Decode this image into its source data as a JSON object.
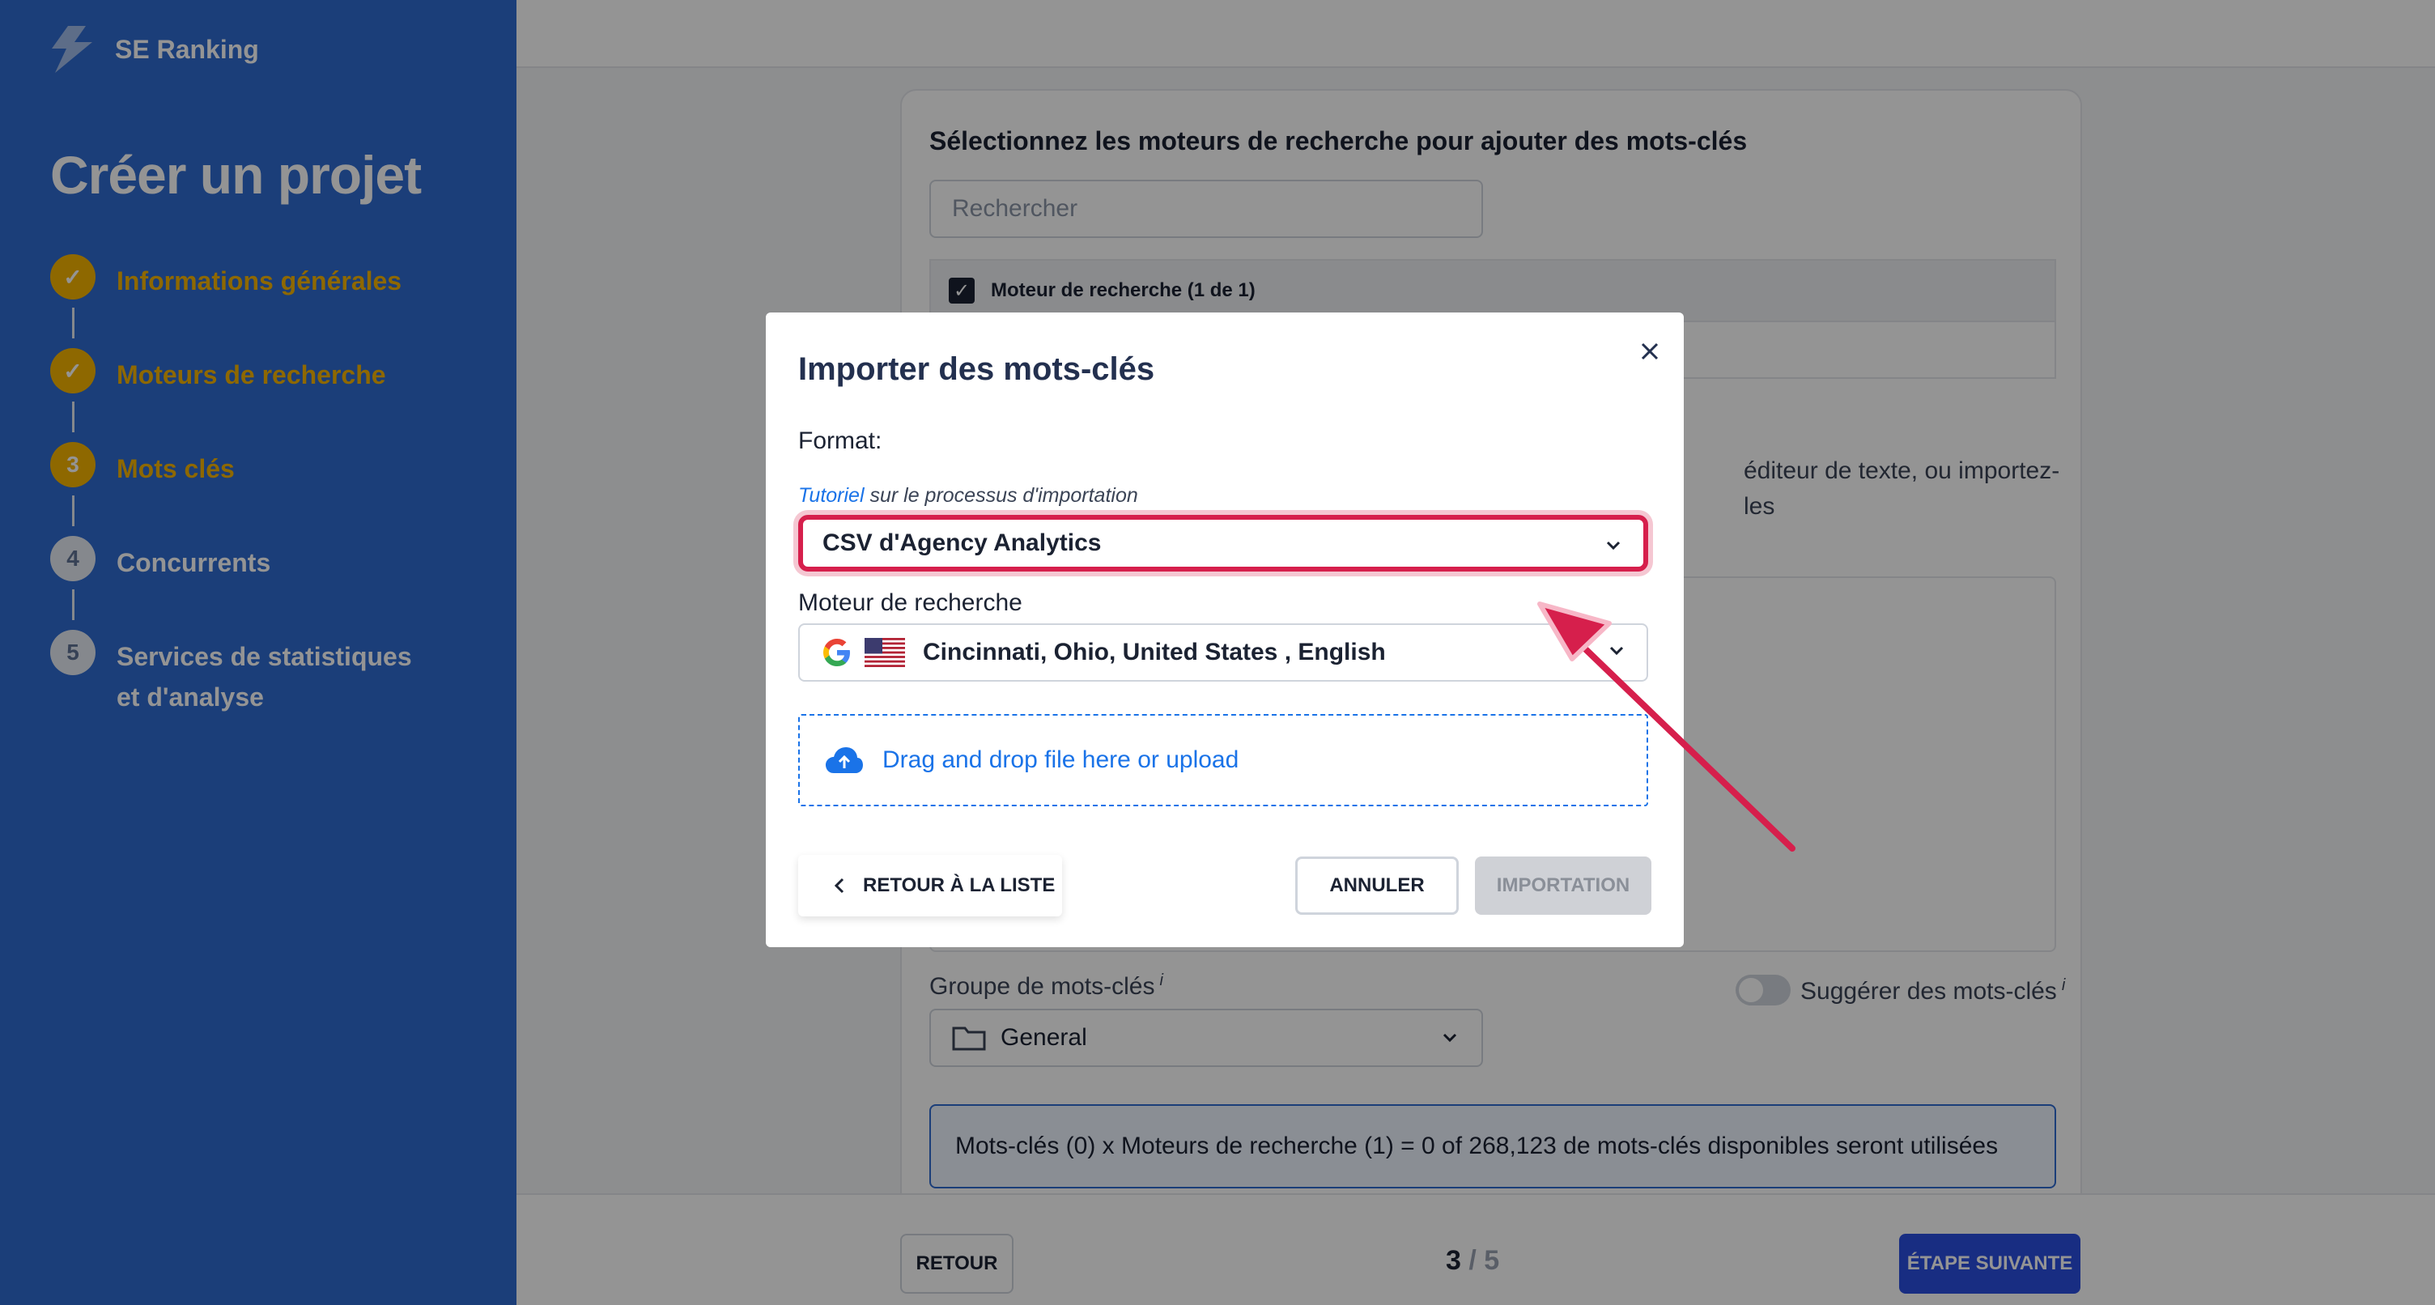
{
  "brand": {
    "name": "SE Ranking"
  },
  "sidebar": {
    "title": "Créer un projet",
    "steps": [
      {
        "number": "1",
        "label": "Informations générales",
        "state": "done"
      },
      {
        "number": "2",
        "label": "Moteurs de recherche",
        "state": "done"
      },
      {
        "number": "3",
        "label": "Mots clés",
        "state": "current"
      },
      {
        "number": "4",
        "label": "Concurrents",
        "state": "todo"
      },
      {
        "number": "5",
        "label": "Services de statistiques et d'analyse",
        "state": "todo"
      }
    ]
  },
  "main": {
    "card_title": "Sélectionnez les moteurs de recherche pour ajouter des mots-clés",
    "search_placeholder": "Rechercher",
    "engines_header": "Moteur de recherche (1 de 1)",
    "description_fragment": "éditeur de texte, ou importez-les",
    "group_label": "Groupe de mots-clés",
    "group_info": "i",
    "group_value": "General",
    "suggest_label": "Suggérer des mots-clés",
    "suggest_info": "i",
    "info_text": "Mots-clés (0) x Moteurs de recherche (1) = 0 of 268,123 de mots-clés disponibles seront utilisées"
  },
  "footer": {
    "back_label": "RETOUR",
    "page_current": "3",
    "page_sep": "/",
    "page_total": "5",
    "next_label": "ÉTAPE SUIVANTE"
  },
  "modal": {
    "title": "Importer des mots-clés",
    "format_label": "Format:",
    "tutorial_link": "Tutoriel",
    "tutorial_rest": " sur le processus d'importation",
    "format_value": "CSV d'Agency Analytics",
    "engine_label": "Moteur de recherche",
    "engine_value": "Cincinnati, Ohio, United States , English",
    "dropzone_text": "Drag and drop file here or upload",
    "back_list_label": "RETOUR À LA LISTE",
    "cancel_label": "ANNULER",
    "import_label": "IMPORTATION"
  },
  "colors": {
    "sidebar_bg": "#2f6bd1",
    "step_done": "#f4b400",
    "highlight": "#d61f4c",
    "link": "#1a73e8",
    "next_button": "#2a4fe0"
  },
  "icons": [
    "se-ranking-logo-icon",
    "check-icon",
    "folder-icon",
    "chevron-down-icon",
    "close-icon",
    "google-icon",
    "us-flag-icon",
    "cloud-upload-icon",
    "chevron-left-icon",
    "arrow-annotation"
  ]
}
